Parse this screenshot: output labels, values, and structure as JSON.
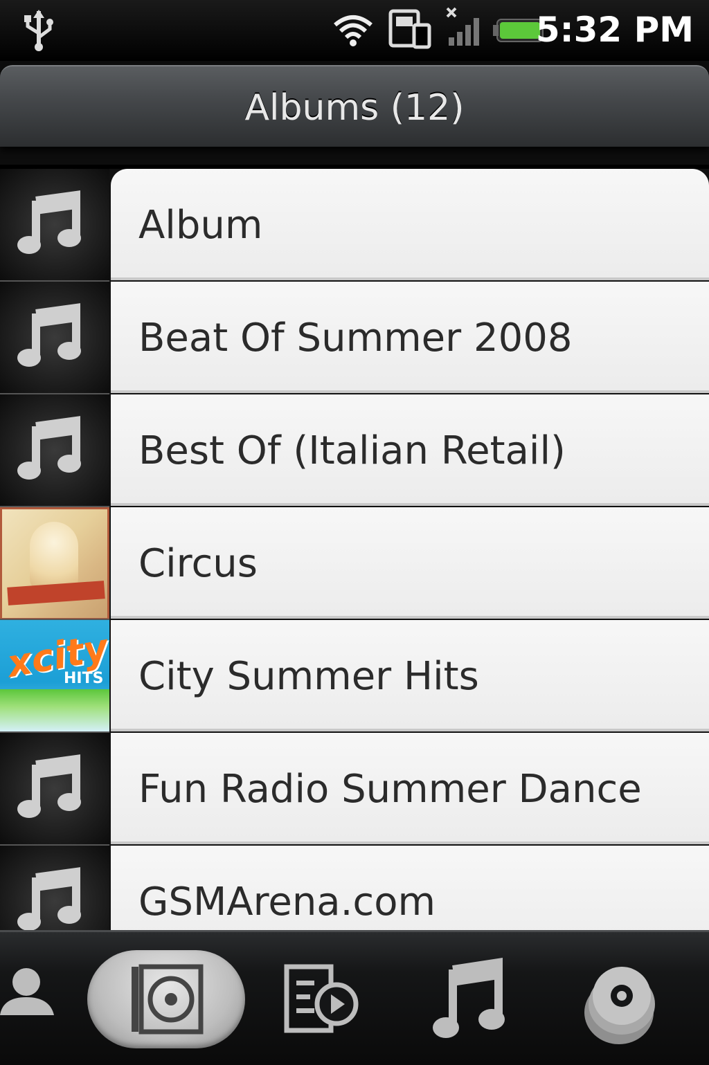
{
  "status_bar": {
    "time": "5:32 PM",
    "icons": [
      "usb-icon",
      "wifi-icon",
      "sync-icon",
      "signal-icon",
      "battery-icon"
    ]
  },
  "header": {
    "title": "Albums (12)"
  },
  "albums": [
    {
      "title": "Album",
      "art": "music-note-icon"
    },
    {
      "title": "Beat Of Summer 2008",
      "art": "music-note-icon"
    },
    {
      "title": "Best Of (Italian Retail)",
      "art": "music-note-icon"
    },
    {
      "title": "Circus",
      "art": "album-cover"
    },
    {
      "title": "City Summer Hits",
      "art": "album-cover",
      "cover_text": "xcity",
      "cover_subtext": "HITS"
    },
    {
      "title": "Fun Radio Summer Dance",
      "art": "music-note-icon"
    },
    {
      "title": "GSMArena.com",
      "art": "music-note-icon"
    }
  ],
  "tabs": [
    {
      "name": "artists",
      "icon": "person-icon",
      "selected": false
    },
    {
      "name": "albums",
      "icon": "album-icon",
      "selected": true
    },
    {
      "name": "playlists",
      "icon": "playlist-icon",
      "selected": false
    },
    {
      "name": "songs",
      "icon": "music-note-icon",
      "selected": false
    },
    {
      "name": "genres",
      "icon": "disc-stack-icon",
      "selected": false
    }
  ],
  "colors": {
    "accent_battery": "#5cc83a",
    "list_bg": "#f2f2f2",
    "header_bg": "#45484b"
  }
}
